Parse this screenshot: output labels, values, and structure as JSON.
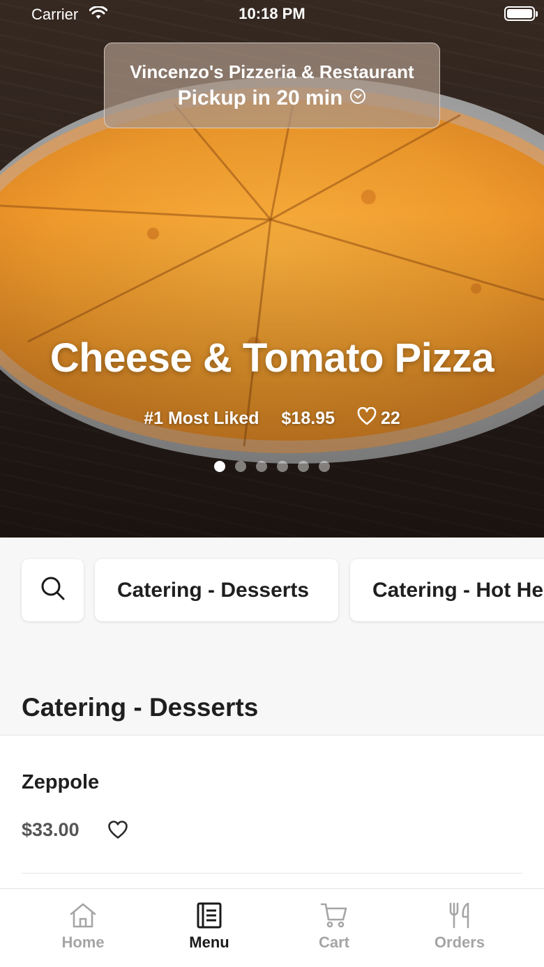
{
  "status_bar": {
    "carrier": "Carrier",
    "time": "10:18 PM"
  },
  "store": {
    "name": "Vincenzo's Pizzeria & Restaurant",
    "pickup": "Pickup in 20 min",
    "pickup_icon": "chevron-down-circle-icon"
  },
  "featured": {
    "title": "Cheese & Tomato Pizza",
    "rank": "#1 Most Liked",
    "price": "$18.95",
    "likes": "22",
    "slide_count": 6,
    "active_slide": 1
  },
  "categories": {
    "search_icon": "search-icon",
    "chips": [
      "Catering - Desserts",
      "Catering - Hot Heroes"
    ]
  },
  "section": {
    "title": "Catering - Desserts",
    "items": [
      {
        "name": "Zeppole",
        "price": "$33.00",
        "favorite": false
      }
    ]
  },
  "tabs": [
    {
      "label": "Home",
      "icon": "home-icon",
      "active": false
    },
    {
      "label": "Menu",
      "icon": "menu-icon",
      "active": true
    },
    {
      "label": "Cart",
      "icon": "cart-icon",
      "active": false
    },
    {
      "label": "Orders",
      "icon": "fork-knife-icon",
      "active": false
    }
  ],
  "colors": {
    "active_tab": "#1a1a1a",
    "inactive_tab": "#a5a5a5",
    "background": "#f7f7f7"
  }
}
